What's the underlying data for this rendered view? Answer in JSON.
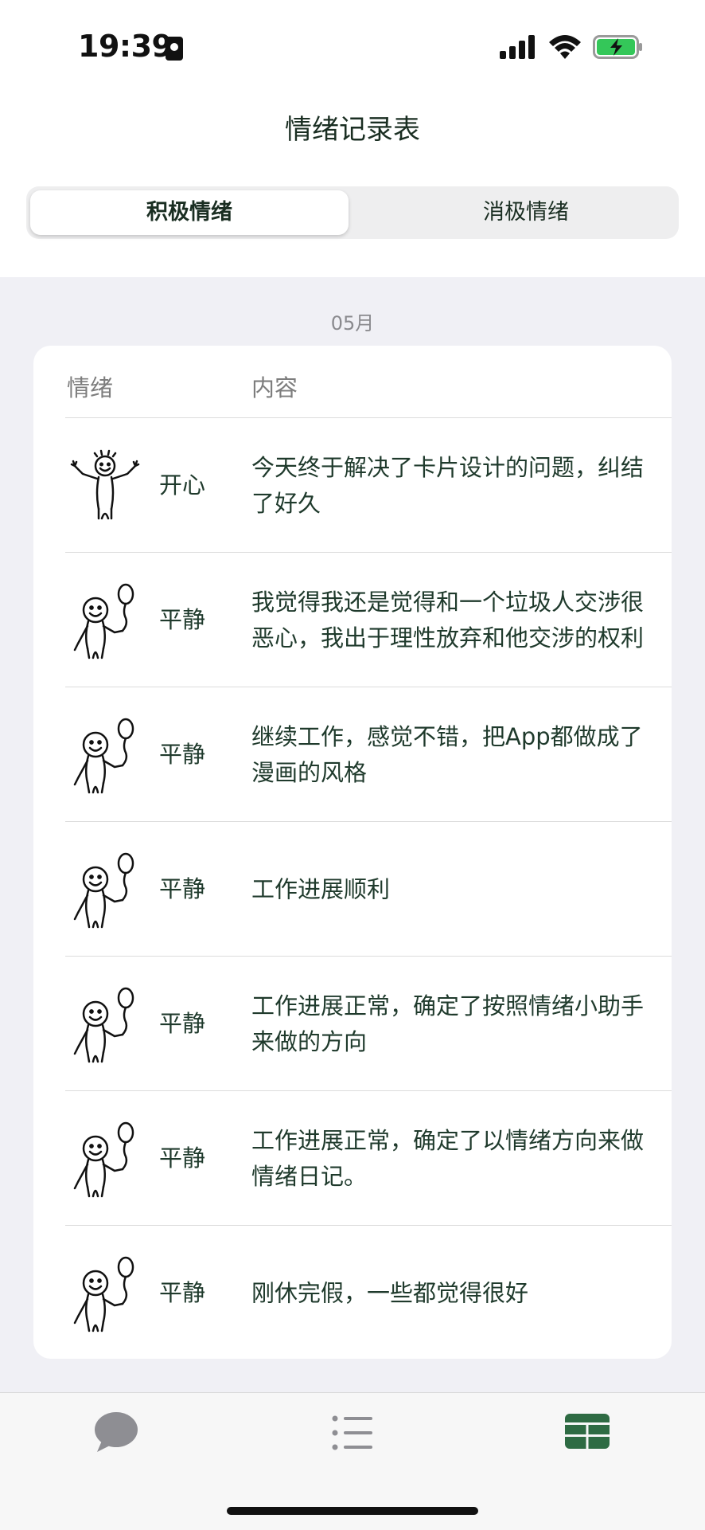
{
  "status_bar": {
    "time": "19:39"
  },
  "header": {
    "title": "情绪记录表"
  },
  "segments": {
    "positive_label": "积极情绪",
    "negative_label": "消极情绪",
    "selected": "积极情绪"
  },
  "table": {
    "month": "05月",
    "columns": {
      "mood": "情绪",
      "content": "内容"
    },
    "rows": [
      {
        "mood": "开心",
        "figure": "cheering-stickman-icon",
        "content": "今天终于解决了卡片设计的问题，纠结了好久"
      },
      {
        "mood": "平静",
        "figure": "balloon-stickman-icon",
        "content": "我觉得我还是觉得和一个垃圾人交涉很恶心，我出于理性放弃和他交涉的权利"
      },
      {
        "mood": "平静",
        "figure": "balloon-stickman-icon",
        "content": "继续工作，感觉不错，把App都做成了漫画的风格"
      },
      {
        "mood": "平静",
        "figure": "balloon-stickman-icon",
        "content": "工作进展顺利"
      },
      {
        "mood": "平静",
        "figure": "balloon-stickman-icon",
        "content": "工作进展正常，确定了按照情绪小助手来做的方向"
      },
      {
        "mood": "平静",
        "figure": "balloon-stickman-icon",
        "content": "工作进展正常，确定了以情绪方向来做情绪日记。"
      },
      {
        "mood": "平静",
        "figure": "balloon-stickman-icon",
        "content": "刚休完假，一些都觉得很好"
      }
    ]
  },
  "tab_bar": {
    "tabs": [
      {
        "icon": "chat-bubble-icon",
        "active": false
      },
      {
        "icon": "list-icon",
        "active": false
      },
      {
        "icon": "table-icon",
        "active": true
      }
    ],
    "active_color": "#2e6b43",
    "inactive_color": "#8e8e93"
  }
}
